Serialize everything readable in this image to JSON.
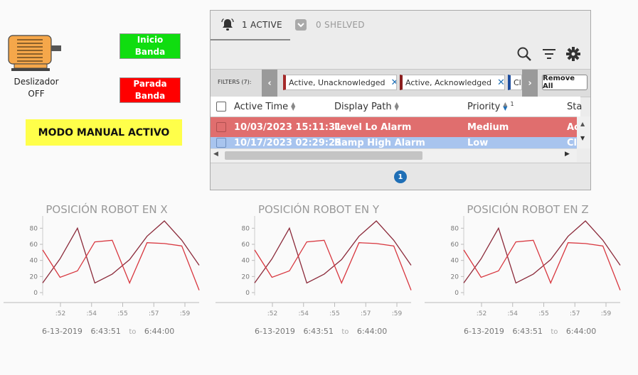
{
  "motor": {
    "label_line1": "Deslizador",
    "label_line2": "OFF"
  },
  "buttons": {
    "start": {
      "line1": "Inicio",
      "line2": "Banda",
      "color": "#10dd10"
    },
    "stop": {
      "line1": "Parada",
      "line2": "Banda",
      "color": "#ff0000"
    }
  },
  "manual_banner": {
    "text": "MODO MANUAL ACTIVO",
    "color": "#ffff4a"
  },
  "alarm_table": {
    "tabs": {
      "active": "1 ACTIVE",
      "shelved": "0 SHELVED"
    },
    "toolbar_icons": [
      "search-icon",
      "filter-icon",
      "gear-icon"
    ],
    "filters_label": "FILTERS (7):",
    "filters": [
      "Active, Unacknowledged",
      "Active, Acknowledged",
      "Cl"
    ],
    "remove_all": "Remove All",
    "columns": [
      "Active Time",
      "Display Path",
      "Priority",
      "Sta"
    ],
    "priority_sort_index": "1",
    "rows": [
      {
        "active_time": "10/03/2023 15:11:31",
        "display_path": "Level Lo Alarm",
        "priority": "Medium",
        "state": "Ac",
        "color": "#e06e6e"
      },
      {
        "active_time": "10/17/2023 02:29:25",
        "display_path": "Ramp High Alarm",
        "priority": "Low",
        "state": "Cl",
        "color": "#a8c4ee"
      }
    ],
    "page": "1"
  },
  "charts_common": {
    "date": "6-13-2019",
    "start_time": "6:43:51",
    "to": "to",
    "end_time": "6:44:00"
  },
  "chart_data": [
    {
      "type": "line",
      "title": "POSICIÓN ROBOT EN X",
      "yticks": [
        0,
        20,
        40,
        60,
        80
      ],
      "ylim": [
        0,
        90
      ],
      "xticks": [
        ":52",
        ":54",
        ":55",
        ":57",
        ":59"
      ],
      "series": [
        {
          "color": "#8b2a3a",
          "values": [
            12,
            42,
            80,
            12,
            23,
            41,
            70,
            89,
            65,
            34
          ]
        },
        {
          "color": "#d8363e",
          "values": [
            53,
            19,
            27,
            63,
            65,
            12,
            62,
            61,
            58,
            3
          ]
        }
      ]
    },
    {
      "type": "line",
      "title": "POSICIÓN ROBOT EN Y",
      "yticks": [
        0,
        20,
        40,
        60,
        80
      ],
      "ylim": [
        0,
        90
      ],
      "xticks": [
        ":52",
        ":54",
        ":55",
        ":57",
        ":59"
      ],
      "series": [
        {
          "color": "#8b2a3a",
          "values": [
            12,
            42,
            80,
            12,
            23,
            41,
            70,
            89,
            65,
            34
          ]
        },
        {
          "color": "#d8363e",
          "values": [
            53,
            19,
            27,
            63,
            65,
            12,
            62,
            61,
            58,
            3
          ]
        }
      ]
    },
    {
      "type": "line",
      "title": "POSICIÓN ROBOT EN Z",
      "yticks": [
        0,
        20,
        40,
        60,
        80
      ],
      "ylim": [
        0,
        90
      ],
      "xticks": [
        ":52",
        ":54",
        ":55",
        ":57",
        ":59"
      ],
      "series": [
        {
          "color": "#8b2a3a",
          "values": [
            12,
            42,
            80,
            12,
            23,
            41,
            70,
            89,
            65,
            34
          ]
        },
        {
          "color": "#d8363e",
          "values": [
            53,
            19,
            27,
            63,
            65,
            12,
            62,
            61,
            58,
            3
          ]
        }
      ]
    }
  ]
}
